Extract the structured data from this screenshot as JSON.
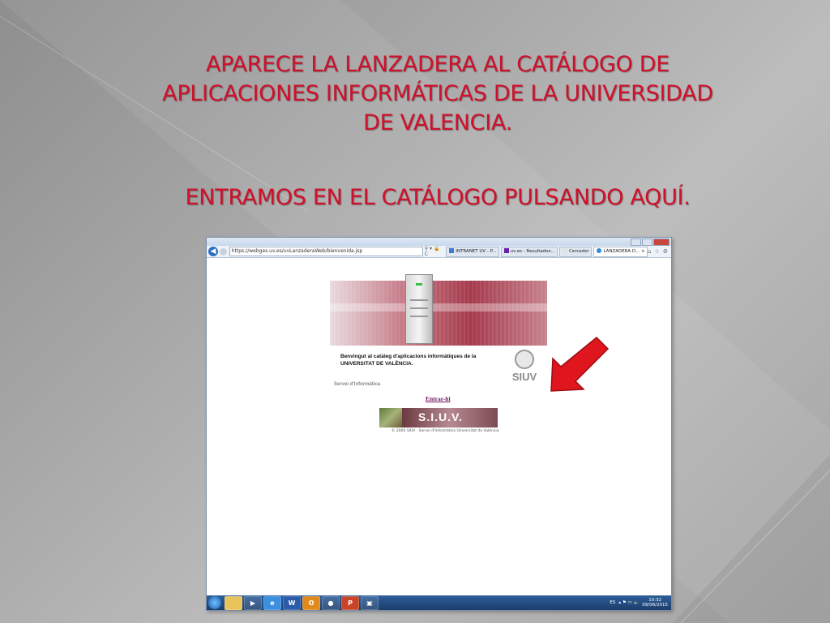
{
  "slide": {
    "title_lines": [
      "APARECE LA LANZADERA AL CATÁLOGO DE",
      "APLICACIONES INFORMÁTICAS DE LA UNIVERSIDAD",
      "DE VALENCIA."
    ],
    "subtitle": "ENTRAMOS EN EL CATÁLOGO PULSANDO AQUÍ.",
    "title_color": "#d0102a",
    "arrow_color": "#e0161e"
  },
  "browser": {
    "url": "https://webges.uv.es/uvLanzaderaWeb/bienvenida.jsp",
    "tabs": [
      {
        "label": "INTRANET UV - P...",
        "icon": "page-icon"
      },
      {
        "label": "uv.es - Resultados...",
        "icon": "yahoo-icon"
      },
      {
        "label": "Cercador",
        "icon": "page-icon"
      },
      {
        "label": "LANZADERA D...",
        "icon": "ie-icon",
        "active": true
      }
    ]
  },
  "page": {
    "welcome_line1": "Benvingut al catàleg d'aplicacions informàtiques de la",
    "welcome_line2": "UNIVERSITAT DE VALÈNCIA.",
    "servei": "Servei d'Informàtica",
    "logo_text": "SIUV",
    "entrar_link": "Entrar-hi",
    "footer_banner_text": "S.I.U.V.",
    "copyright": "© 2004 SIUV · Servei d'Informàtica Universitat de València"
  },
  "taskbar": {
    "apps": [
      "explorer-icon",
      "media-icon",
      "ie-icon",
      "word-icon",
      "outlook-icon",
      "chrome-icon",
      "powerpoint-icon",
      "network-icon"
    ],
    "language": "ES",
    "time": "10:32",
    "date": "09/06/2015"
  }
}
